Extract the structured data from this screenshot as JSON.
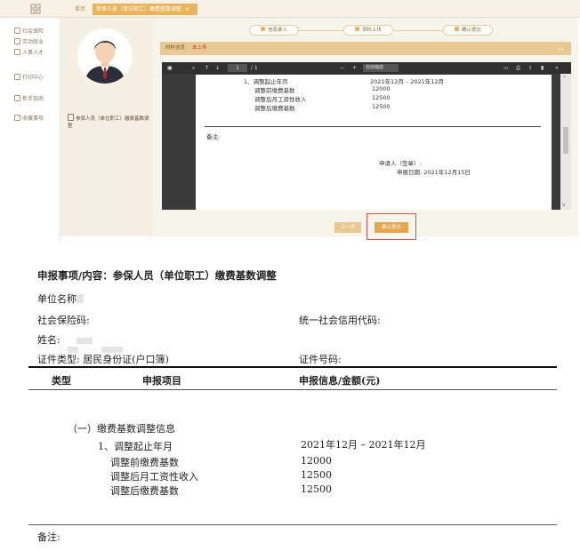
{
  "app": {
    "tabs": {
      "home": "首页",
      "active": "参保人员（单位职工）缴费基数调整",
      "close": "×"
    },
    "sidebar": {
      "items": [
        {
          "label": "社会保险",
          "icon": "shield-icon"
        },
        {
          "label": "劳动就业",
          "icon": "briefcase-icon"
        },
        {
          "label": "人事人才",
          "icon": "person-icon"
        },
        {
          "label": "打印中心",
          "icon": "printer-icon"
        },
        {
          "label": "新手指南",
          "icon": "guide-icon"
        },
        {
          "label": "收藏事项",
          "icon": "star-icon"
        }
      ]
    },
    "profile": {
      "doc_item": "参保人员（单位职工）缴费基数调整"
    },
    "steps": [
      "信息录入",
      "资料上传",
      "确认提交"
    ],
    "status": {
      "label": "材料信息",
      "value": "未上传"
    },
    "viewer": {
      "toolbar": {
        "page": "1",
        "total": "/ 1",
        "minus": "−",
        "plus": "+",
        "zoom": "自动缩放"
      },
      "lines": {
        "l1_label": "1、调整起止年月",
        "l1_value": "2021年12月   –   2021年12月",
        "l2_label": "调整前缴费基数",
        "l2_value": "12000",
        "l3_label": "调整后月工资性收入",
        "l3_value": "12500",
        "l4_label": "调整后缴费基数",
        "l4_value": "12500",
        "remark": "备注:",
        "applicant": "申请人（签章）:",
        "date": "申报日期:   2021年12月15日"
      }
    },
    "buttons": {
      "prev": "上一步",
      "confirm": "确认提交"
    }
  },
  "document": {
    "title": "申报事项/内容：参保人员（单位职工）缴费基数调整",
    "unit_name_label": "单位名称",
    "social_code_label": "社会保险码:",
    "credit_code_label": "统一社会信用代码:",
    "name_label": "姓名:",
    "id_type": "证件类型:  居民身份证(户口簿)",
    "id_number_label": "证件号码:",
    "headers": {
      "type": "类型",
      "item": "申报项目",
      "info": "申报信息/金额(元)"
    },
    "section": "（一）缴费基数调整信息",
    "rows": [
      {
        "label": "1、调整起止年月",
        "value": "2021年12月   –   2021年12月"
      },
      {
        "label": "调整前缴费基数",
        "value": "12000"
      },
      {
        "label": "调整后月工资性收入",
        "value": "12500"
      },
      {
        "label": "调整后缴费基数",
        "value": "12500"
      }
    ],
    "remark": "备注:"
  },
  "colors": {
    "accent": "#e8b45c",
    "panel": "#f5f0e3",
    "alert": "#c0392b",
    "highlight": "#d9534f"
  }
}
